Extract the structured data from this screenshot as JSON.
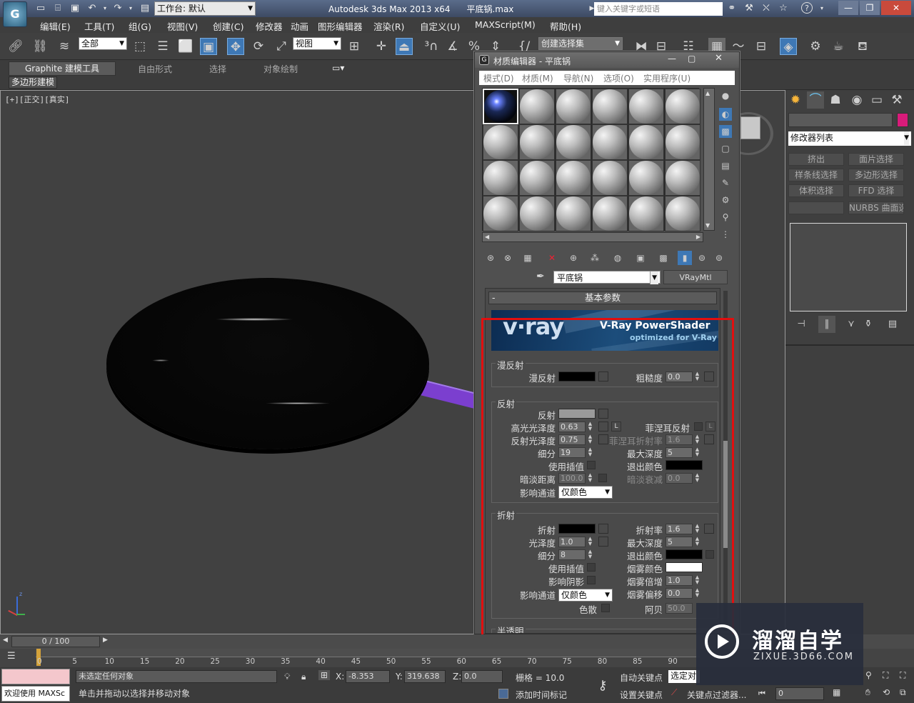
{
  "titlebar": {
    "workspace": "工作台: 默认",
    "app_title": "Autodesk 3ds Max  2013 x64",
    "file_name": "平底锅.max",
    "search_placeholder": "键入关键字或短语"
  },
  "menu": [
    "编辑(E)",
    "工具(T)",
    "组(G)",
    "视图(V)",
    "创建(C)",
    "修改器",
    "动画",
    "图形编辑器",
    "渲染(R)",
    "自定义(U)",
    "MAXScript(M)",
    "帮助(H)"
  ],
  "toolbar": {
    "selection_filter": "全部",
    "ref_coord": "视图",
    "named_set": "创建选择集"
  },
  "ribbon": {
    "tabs": [
      "Graphite 建模工具",
      "自由形式",
      "选择",
      "对象绘制"
    ],
    "sub_tab": "多边形建模"
  },
  "viewport": {
    "label": "[+][正交][真实]"
  },
  "material_editor": {
    "title": "材质编辑器 - 平底锅",
    "menu": [
      "模式(D)",
      "材质(M)",
      "导航(N)",
      "选项(O)",
      "实用程序(U)"
    ],
    "material_name": "平底锅",
    "material_type": "VRayMtl",
    "rollout_title": "基本参数",
    "banner": {
      "logo": "v·ray",
      "product": "V-Ray PowerShader",
      "tagline": "optimized for V-Ray"
    },
    "diffuse": {
      "group": "漫反射",
      "diffuse_label": "漫反射",
      "roughness_label": "粗糙度",
      "roughness": "0.0"
    },
    "reflection": {
      "group": "反射",
      "reflect_label": "反射",
      "hilight_gloss_label": "高光光泽度",
      "hilight_gloss": "0.63",
      "lock": "L",
      "refl_gloss_label": "反射光泽度",
      "refl_gloss": "0.75",
      "subdivs_label": "细分",
      "subdivs": "19",
      "use_interp_label": "使用插值",
      "dim_dist_label": "暗淡距离",
      "dim_dist": "100.0",
      "affect_channels_label": "影响通道",
      "affect_channels": "仅颜色",
      "fresnel_label": "菲涅耳反射",
      "fresnel_lock": "L",
      "fresnel_ior_label": "菲涅耳折射率",
      "fresnel_ior": "1.6",
      "max_depth_label": "最大深度",
      "max_depth": "5",
      "exit_color_label": "退出颜色",
      "dim_falloff_label": "暗淡衰减",
      "dim_falloff": "0.0"
    },
    "refraction": {
      "group": "折射",
      "refract_label": "折射",
      "gloss_label": "光泽度",
      "gloss": "1.0",
      "subdivs_label": "细分",
      "subdivs": "8",
      "use_interp_label": "使用插值",
      "affect_shadows_label": "影响阴影",
      "affect_channels_label": "影响通道",
      "affect_channels": "仅颜色",
      "dispersion_label": "色散",
      "ior_label": "折射率",
      "ior": "1.6",
      "max_depth_label": "最大深度",
      "max_depth": "5",
      "exit_color_label": "退出颜色",
      "fog_color_label": "烟雾颜色",
      "fog_mult_label": "烟雾倍增",
      "fog_mult": "1.0",
      "fog_bias_label": "烟雾偏移",
      "fog_bias": "0.0",
      "abbe_label": "阿贝",
      "abbe": "50.0"
    },
    "next_group": "半透明"
  },
  "command_panel": {
    "modifier_list": "修改器列表",
    "buttons": [
      "挤出",
      "面片选择",
      "样条线选择",
      "多边形选择",
      "体积选择",
      "FFD 选择",
      "",
      "NURBS 曲面选择"
    ]
  },
  "timeline": {
    "frame": "0 / 100",
    "ticks": [
      "0",
      "5",
      "10",
      "15",
      "20",
      "25",
      "30",
      "35",
      "40",
      "45",
      "50",
      "55",
      "60",
      "65",
      "70",
      "75",
      "80",
      "85",
      "90"
    ]
  },
  "status": {
    "script_prompt": "欢迎使用 MAXSc",
    "selection": "未选定任何对象",
    "hint": "单击并拖动以选择并移动对象",
    "x_label": "X:",
    "x": "-8.353",
    "y_label": "Y:",
    "y": "319.638",
    "z_label": "Z:",
    "z": "0.0",
    "grid": "栅格 = 10.0",
    "add_time_tag": "添加时间标记",
    "auto_key": "自动关键点",
    "set_key": "设置关键点",
    "selected": "选定对",
    "key_filters": "关键点过滤器...",
    "frame": "0"
  },
  "watermark": {
    "name": "溜溜自学",
    "url": "ZIXUE.3D66.COM"
  },
  "colors": {
    "highlight_box": "#e10f0f",
    "selected_tool": "#3e78b5",
    "object_color": "#d81b7a",
    "handle": "#7b3fcf"
  }
}
